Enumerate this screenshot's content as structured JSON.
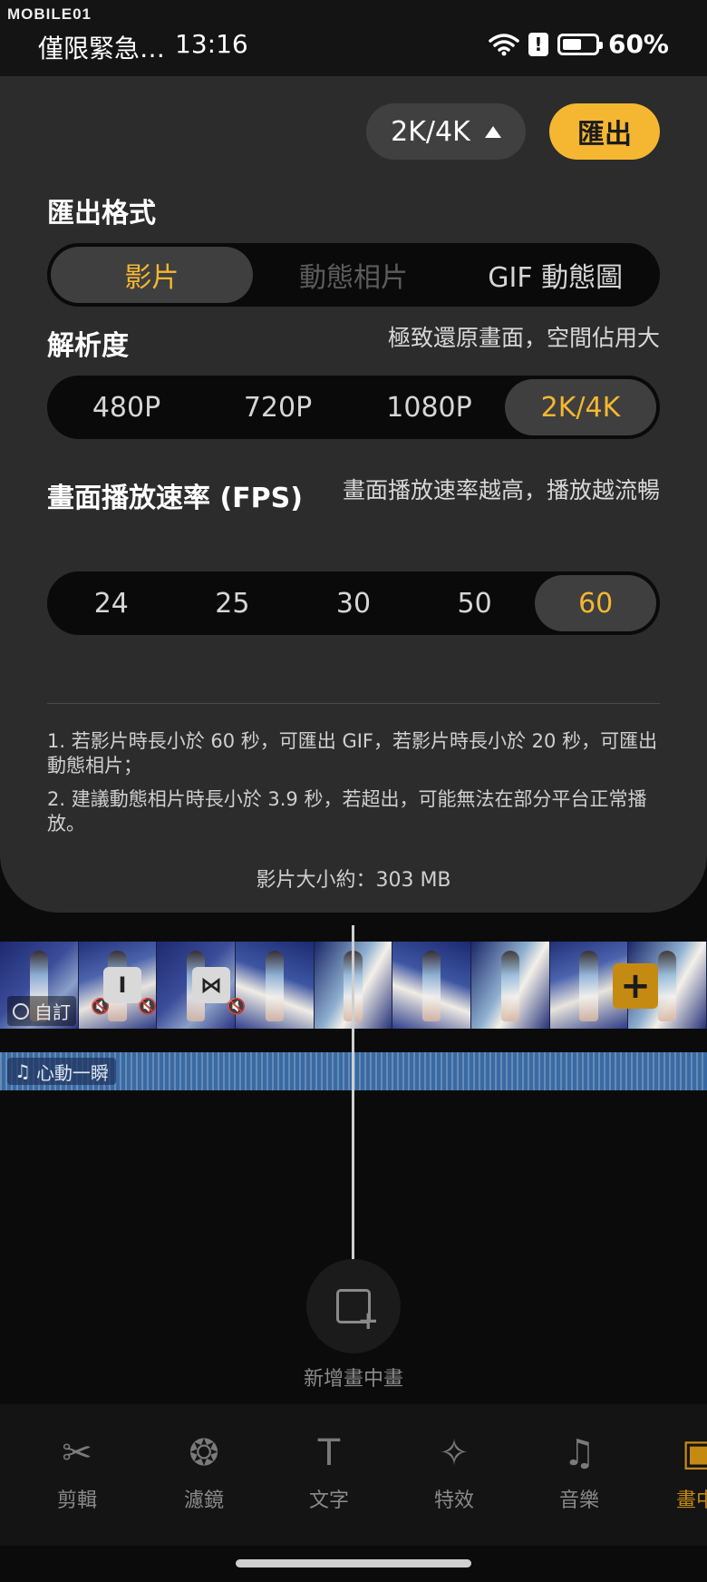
{
  "status_bar": {
    "watermark": "MOBILE01",
    "carrier": "僅限緊急…",
    "time": "13:16",
    "alert_glyph": "!",
    "battery_level": 0.6,
    "battery": "60%"
  },
  "export_sheet": {
    "resolution_chip": "2K/4K",
    "export_button": "匯出",
    "format_label": "匯出格式",
    "format_options": [
      "影片",
      "動態相片",
      "GIF 動態圖"
    ],
    "format_selected": "影片",
    "resolution_label": "解析度",
    "resolution_hint": "極致還原畫面，空間佔用大",
    "resolution_options": [
      "480P",
      "720P",
      "1080P",
      "2K/4K"
    ],
    "resolution_selected": "2K/4K",
    "fps_label": "畫面播放速率 (FPS)",
    "fps_hint": "畫面播放速率越高，播放越流暢",
    "fps_options": [
      "24",
      "25",
      "30",
      "50",
      "60"
    ],
    "fps_selected": "60",
    "notes": [
      "1. 若影片時長小於 60 秒，可匯出 GIF，若影片時長小於 20 秒，可匯出動態相片；",
      "2. 建議動態相片時長小於 3.9 秒，若超出，可能無法在部分平台正常播放。"
    ],
    "size_text": "影片大小約：303 MB"
  },
  "timeline": {
    "clip_tag": "自訂",
    "transition_1": "I",
    "transition_2": "⋈",
    "add_clip": "+",
    "audio_name": "心動一瞬"
  },
  "pip": {
    "label": "新增畫中畫"
  },
  "toolbar": {
    "items": [
      {
        "label": "剪輯",
        "icon": "scissors-icon",
        "glyph": "✂"
      },
      {
        "label": "濾鏡",
        "icon": "filter-icon",
        "glyph": "❂"
      },
      {
        "label": "文字",
        "icon": "text-icon",
        "glyph": "T"
      },
      {
        "label": "特效",
        "icon": "effects-icon",
        "glyph": "✧"
      },
      {
        "label": "音樂",
        "icon": "music-icon",
        "glyph": "♫"
      },
      {
        "label": "畫中",
        "icon": "pip-icon",
        "glyph": "▣"
      }
    ]
  },
  "colors": {
    "accent": "#f5b731",
    "sheet_bg": "#2c2c2c",
    "audio_track": "#3a6aa3"
  }
}
